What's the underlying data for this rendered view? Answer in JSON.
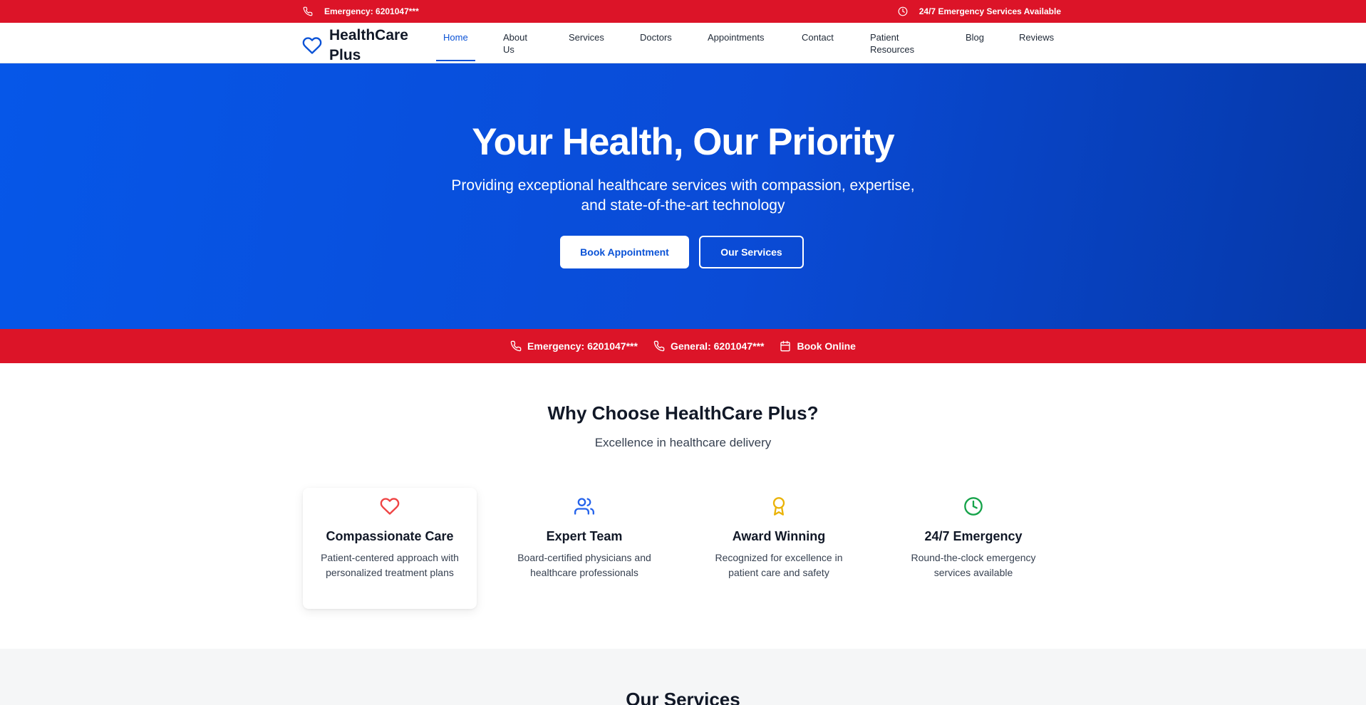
{
  "topbar": {
    "emergency": "Emergency: 6201047***",
    "availability": "24/7 Emergency Services Available"
  },
  "header": {
    "logo": "HealthCare Plus",
    "nav": [
      "Home",
      "About Us",
      "Services",
      "Doctors",
      "Appointments",
      "Contact",
      "Patient Resources",
      "Blog",
      "Reviews"
    ],
    "active": "Home"
  },
  "hero": {
    "title": "Your Health, Our Priority",
    "subtitle": "Providing exceptional healthcare services with compassion, expertise, and state-of-the-art technology",
    "primary_button": "Book Appointment",
    "secondary_button": "Our Services"
  },
  "strip": {
    "emergency": "Emergency: 6201047***",
    "general": "General: 6201047***",
    "book": "Book Online"
  },
  "why": {
    "title": "Why Choose HealthCare Plus?",
    "subtitle": "Excellence in healthcare delivery",
    "features": [
      {
        "title": "Compassionate Care",
        "desc": "Patient-centered approach with personalized treatment plans",
        "icon": "heart-icon",
        "color": "#ef4444"
      },
      {
        "title": "Expert Team",
        "desc": "Board-certified physicians and healthcare professionals",
        "icon": "users-icon",
        "color": "#2563eb"
      },
      {
        "title": "Award Winning",
        "desc": "Recognized for excellence in patient care and safety",
        "icon": "award-icon",
        "color": "#eab308"
      },
      {
        "title": "24/7 Emergency",
        "desc": "Round-the-clock emergency services available",
        "icon": "clock-icon",
        "color": "#16a34a"
      }
    ]
  },
  "services": {
    "title": "Our Services"
  },
  "colors": {
    "brand_red": "#dc1428",
    "brand_blue": "#0a52d6"
  }
}
